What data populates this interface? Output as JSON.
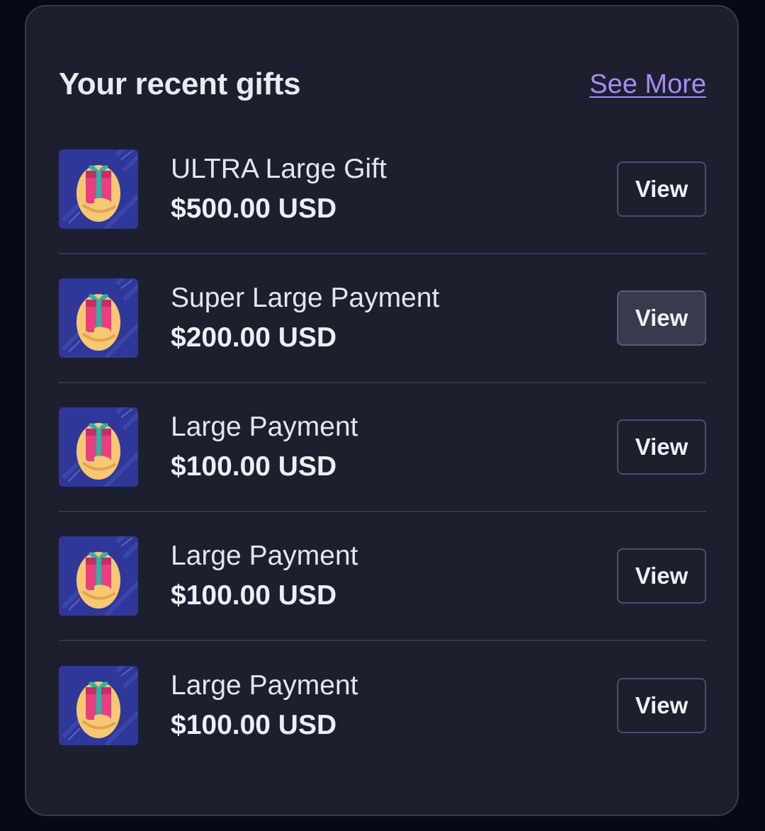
{
  "card": {
    "title": "Your recent gifts",
    "see_more": "See More"
  },
  "gifts": [
    {
      "name": "ULTRA Large Gift",
      "amount": "$500.00 USD",
      "button": "View",
      "icon": "gift-in-hand-icon"
    },
    {
      "name": "Super Large Payment",
      "amount": "$200.00 USD",
      "button": "View",
      "icon": "gift-in-hand-icon",
      "hovered": true
    },
    {
      "name": "Large Payment",
      "amount": "$100.00 USD",
      "button": "View",
      "icon": "gift-in-hand-icon"
    },
    {
      "name": "Large Payment",
      "amount": "$100.00 USD",
      "button": "View",
      "icon": "gift-in-hand-icon"
    },
    {
      "name": "Large Payment",
      "amount": "$100.00 USD",
      "button": "View",
      "icon": "gift-in-hand-icon"
    }
  ],
  "colors": {
    "background": "#060916",
    "card": "#1c1f2e",
    "link": "#a98bf4",
    "thumb_background": "#2f3899",
    "hand": "#f7c873",
    "gift_box": "#e93f7e",
    "ribbon": "#2bb5a5"
  }
}
